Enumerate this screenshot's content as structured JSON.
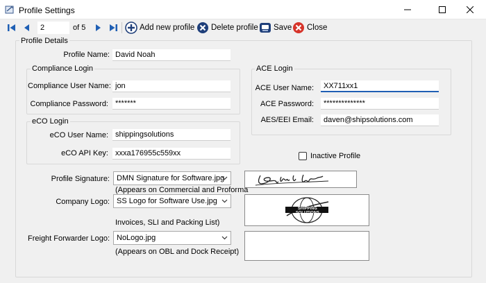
{
  "window": {
    "title": "Profile Settings",
    "minimize_icon": "minimize-icon",
    "maximize_icon": "maximize-icon",
    "close_icon": "close-icon"
  },
  "toolbar": {
    "record_current": "2",
    "record_total": "of 5",
    "add_label": "Add new profile",
    "delete_label": "Delete profile",
    "save_label": "Save",
    "close_label": "Close",
    "colors": {
      "nav": "#1f5fb4",
      "close_red": "#d6342a"
    }
  },
  "profile": {
    "section_title": "Profile Details",
    "name_label": "Profile Name:",
    "name_value": "David Noah"
  },
  "compliance": {
    "section_title": "Compliance Login",
    "user_label": "Compliance User Name:",
    "user_value": "jon",
    "password_label": "Compliance Password:",
    "password_value": "*******"
  },
  "eco": {
    "section_title": "eCO Login",
    "user_label": "eCO User Name:",
    "user_value": "shippingsolutions",
    "apikey_label": "eCO API Key:",
    "apikey_value": "xxxa176955c559xx"
  },
  "ace": {
    "section_title": "ACE Login",
    "user_label": "ACE User Name:",
    "user_value": "XX711xx1",
    "password_label": "ACE Password:",
    "password_value": "**************",
    "email_label": "AES/EEI Email:",
    "email_value": "daven@shipsolutions.com"
  },
  "inactive": {
    "label": "Inactive Profile",
    "checked": false
  },
  "signature": {
    "label": "Profile Signature:",
    "value": "DMN Signature for Software.jpg",
    "note": "(Appears on Commercial and Proforma"
  },
  "company_logo": {
    "label": "Company Logo:",
    "value": "SS Logo for Software Use.jpg",
    "note": "Invoices, SLI and Packing List)",
    "logo_text": "SHIPPING SOLUTIONS"
  },
  "forwarder_logo": {
    "label": "Freight Forwarder Logo:",
    "value": "NoLogo.jpg",
    "note": "(Appears on OBL and Dock Receipt)"
  }
}
